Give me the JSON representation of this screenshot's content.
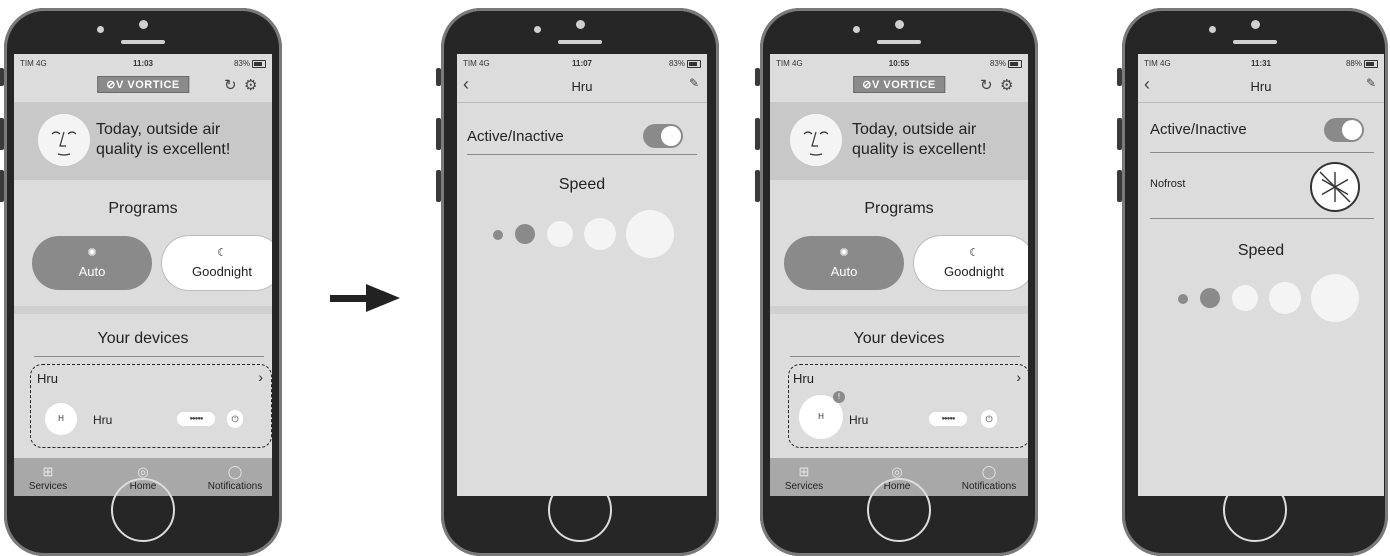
{
  "transition_arrow": "right-arrow-icon",
  "colors": {
    "screen": "#dcdcdc",
    "banner": "#c8c8c8",
    "tabbar": "#a8a8a8",
    "phone_body": "#262626",
    "active_program": "#8a8a8a"
  },
  "phone1": {
    "status": {
      "carrier": "TIM 4G",
      "time": "11:03",
      "battery": "83%"
    },
    "brand": "VORTICE",
    "banner_text": "Today, outside air quality is excellent!",
    "programs_title": "Programs",
    "programs": [
      {
        "label": "Auto",
        "icon": "fan-icon",
        "active": true
      },
      {
        "label": "Goodnight",
        "icon": "moon-icon",
        "active": false
      }
    ],
    "devices_title": "Your devices",
    "device_group": "Hru",
    "device": {
      "avatar_letter": "H",
      "name": "Hru"
    },
    "tabs": [
      {
        "label": "Services",
        "icon": "services-icon"
      },
      {
        "label": "Home",
        "icon": "home-icon"
      },
      {
        "label": "Notifications",
        "icon": "bell-icon"
      }
    ]
  },
  "phone2": {
    "status": {
      "carrier": "TIM 4G",
      "time": "11:07",
      "battery": "83%"
    },
    "title": "Hru",
    "active_label": "Active/Inactive",
    "active": true,
    "speed_title": "Speed",
    "speed_levels": 5,
    "speed_selected": 2
  },
  "phone3": {
    "status": {
      "carrier": "TIM 4G",
      "time": "10:55",
      "battery": "83%"
    },
    "brand": "VORTICE",
    "banner_text": "Today, outside air quality is excellent!",
    "programs_title": "Programs",
    "programs": [
      {
        "label": "Auto",
        "icon": "fan-icon",
        "active": true
      },
      {
        "label": "Goodnight",
        "icon": "moon-icon",
        "active": false
      }
    ],
    "devices_title": "Your devices",
    "device_group": "Hru",
    "device": {
      "avatar_letter": "H",
      "name": "Hru",
      "alert": "!"
    },
    "tabs": [
      {
        "label": "Services",
        "icon": "services-icon"
      },
      {
        "label": "Home",
        "icon": "home-icon"
      },
      {
        "label": "Notifications",
        "icon": "bell-icon"
      }
    ]
  },
  "phone4": {
    "status": {
      "carrier": "TIM 4G",
      "time": "11:31",
      "battery": "88%"
    },
    "title": "Hru",
    "active_label": "Active/Inactive",
    "active": true,
    "nofrost_label": "Nofrost",
    "speed_title": "Speed",
    "speed_levels": 5,
    "speed_selected": 2
  }
}
